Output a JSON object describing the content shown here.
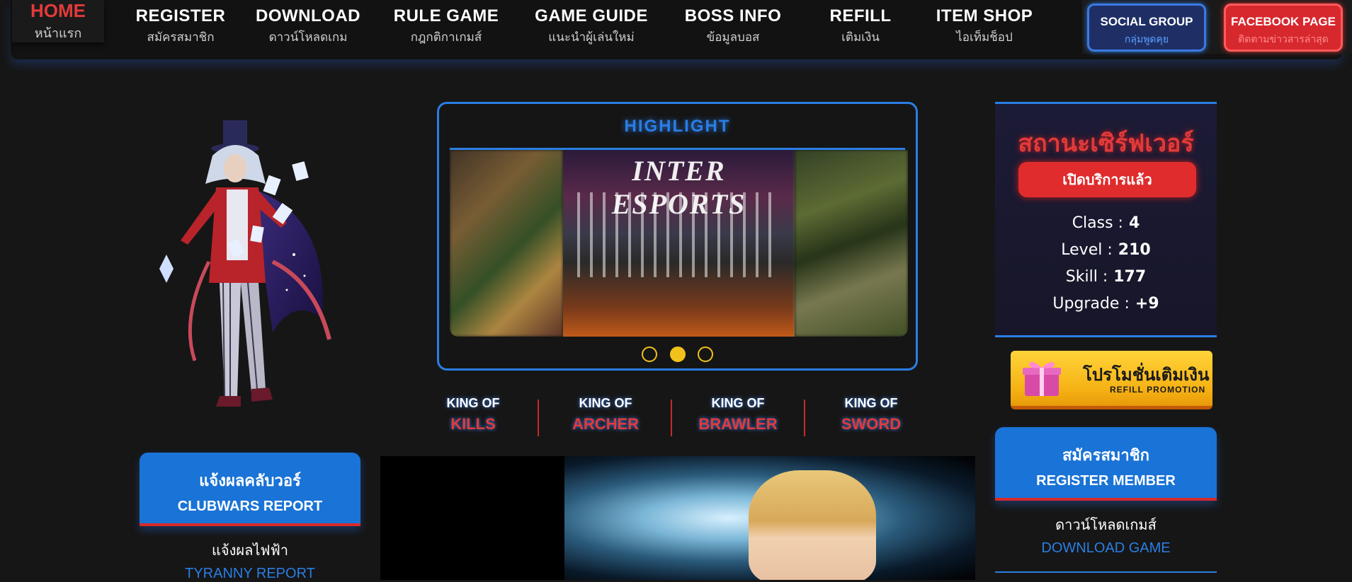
{
  "nav": {
    "home": {
      "en": "HOME",
      "th": "หน้าแรก"
    },
    "items": [
      {
        "en": "REGISTER",
        "th": "สมัครสมาชิก"
      },
      {
        "en": "DOWNLOAD",
        "th": "ดาวน์โหลดเกม"
      },
      {
        "en": "RULE GAME",
        "th": "กฎกติกาเกมส์"
      },
      {
        "en": "GAME GUIDE",
        "th": "แนะนำผู้เล่นใหม่"
      },
      {
        "en": "BOSS INFO",
        "th": "ข้อมูลบอส"
      },
      {
        "en": "REFILL",
        "th": "เติมเงิน"
      },
      {
        "en": "ITEM SHOP",
        "th": "ไอเท็มช็อป"
      }
    ],
    "social": {
      "en": "SOCIAL GROUP",
      "th": "กลุ่มพูดคุย"
    },
    "facebook": {
      "en": "FACEBOOK PAGE",
      "th": "ติดตามข่าวสารล่าสุด"
    }
  },
  "highlight": {
    "title": "HIGHLIGHT",
    "slide_caption": "INTER ESPORTS",
    "dots_count": 3,
    "active_dot": 1
  },
  "kings": [
    {
      "line1": "KING OF",
      "line2": "KILLS"
    },
    {
      "line1": "KING OF",
      "line2": "ARCHER"
    },
    {
      "line1": "KING OF",
      "line2": "BRAWLER"
    },
    {
      "line1": "KING OF",
      "line2": "SWORD"
    }
  ],
  "left_box": {
    "head_th": "แจ้งผลคลับวอร์",
    "head_en": "CLUBWARS REPORT",
    "row_th": "แจ้งผลไฟฟ้า",
    "row_en": "TYRANNY REPORT"
  },
  "server": {
    "title": "สถานะเซิร์ฟเวอร์",
    "status": "เปิดบริการแล้ว",
    "stats": [
      {
        "label": "Class :",
        "value": "4"
      },
      {
        "label": "Level :",
        "value": "210"
      },
      {
        "label": "Skill :",
        "value": "177"
      },
      {
        "label": "Upgrade :",
        "value": "+9"
      }
    ]
  },
  "promo": {
    "th": "โปรโมชั่นเติมเงิน",
    "en": "REFILL PROMOTION"
  },
  "right_box": {
    "head_th": "สมัครสมาชิก",
    "head_en": "REGISTER MEMBER",
    "row_th": "ดาวน์โหลดเกมส์",
    "row_en": "DOWNLOAD GAME"
  },
  "colors": {
    "accent_blue": "#2a7ee4",
    "accent_red": "#e23a3a",
    "gold": "#f2c21b",
    "bg": "#161616"
  }
}
